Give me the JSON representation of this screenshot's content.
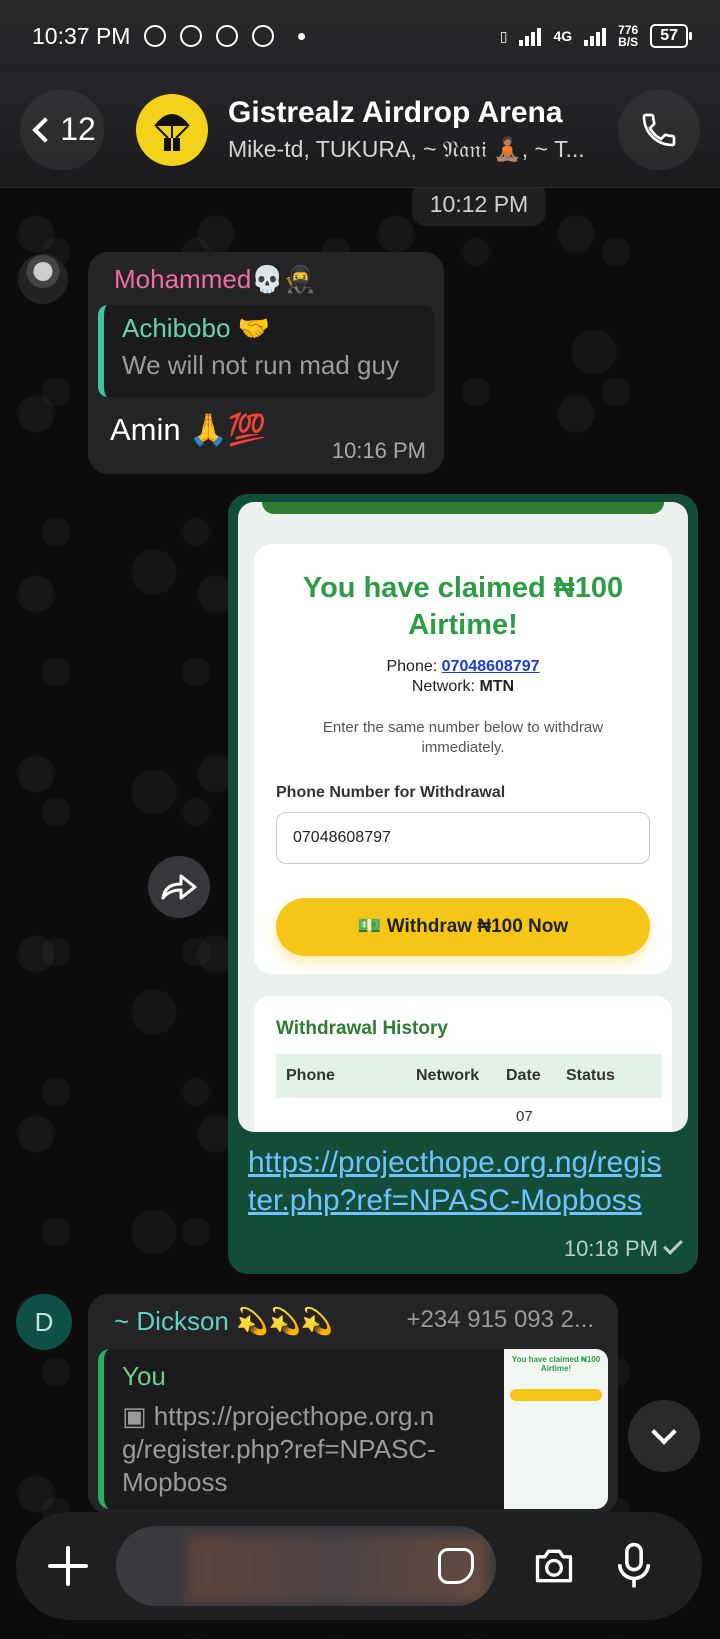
{
  "status_bar": {
    "time": "10:37 PM",
    "network": "4G",
    "speed": "776",
    "speed_unit": "B/S",
    "battery": "57"
  },
  "header": {
    "back_count": "12",
    "title": "Gistrealz Airdrop Arena",
    "subtitle": "Mike-td, TUKURA, ~ 𝔑𝔞𝔫𝔦 🧘🏽, ~ T..."
  },
  "chat": {
    "date_chip": "10:12 PM",
    "msg1": {
      "sender": "Mohammed💀🥷",
      "quote_name": "Achibobo 🤝",
      "quote_text": "We will not run mad guy",
      "body": "Amin 🙏💯",
      "time": "10:16 PM"
    },
    "msg2": {
      "shot": {
        "title": "You have claimed ₦100 Airtime!",
        "phone_label": "Phone:",
        "phone": "07048608797",
        "network_label": "Network:",
        "network": "MTN",
        "hint": "Enter the same number below to withdraw immediately.",
        "input_label": "Phone Number for Withdrawal",
        "input_value": "07048608797",
        "button": "💵 Withdraw ₦100 Now",
        "history_title": "Withdrawal History",
        "columns": [
          "Phone",
          "Network",
          "Date",
          "Status"
        ],
        "row_date": "07"
      },
      "link": "https://projecthope.org.ng/register.php?ref=NPASC-Mopboss",
      "time": "10:18 PM"
    },
    "msg3": {
      "avatar_letter": "D",
      "sender": "~ Dickson 💫💫💫",
      "phone": "+234 915 093 2...",
      "reply_you": "You",
      "reply_link": "https://projecthope.org.ng/register.php?ref=NPASC-Mopboss",
      "thumb_title": "You have claimed ₦100 Airtime!"
    }
  },
  "input_bar": {
    "placeholder": ""
  }
}
